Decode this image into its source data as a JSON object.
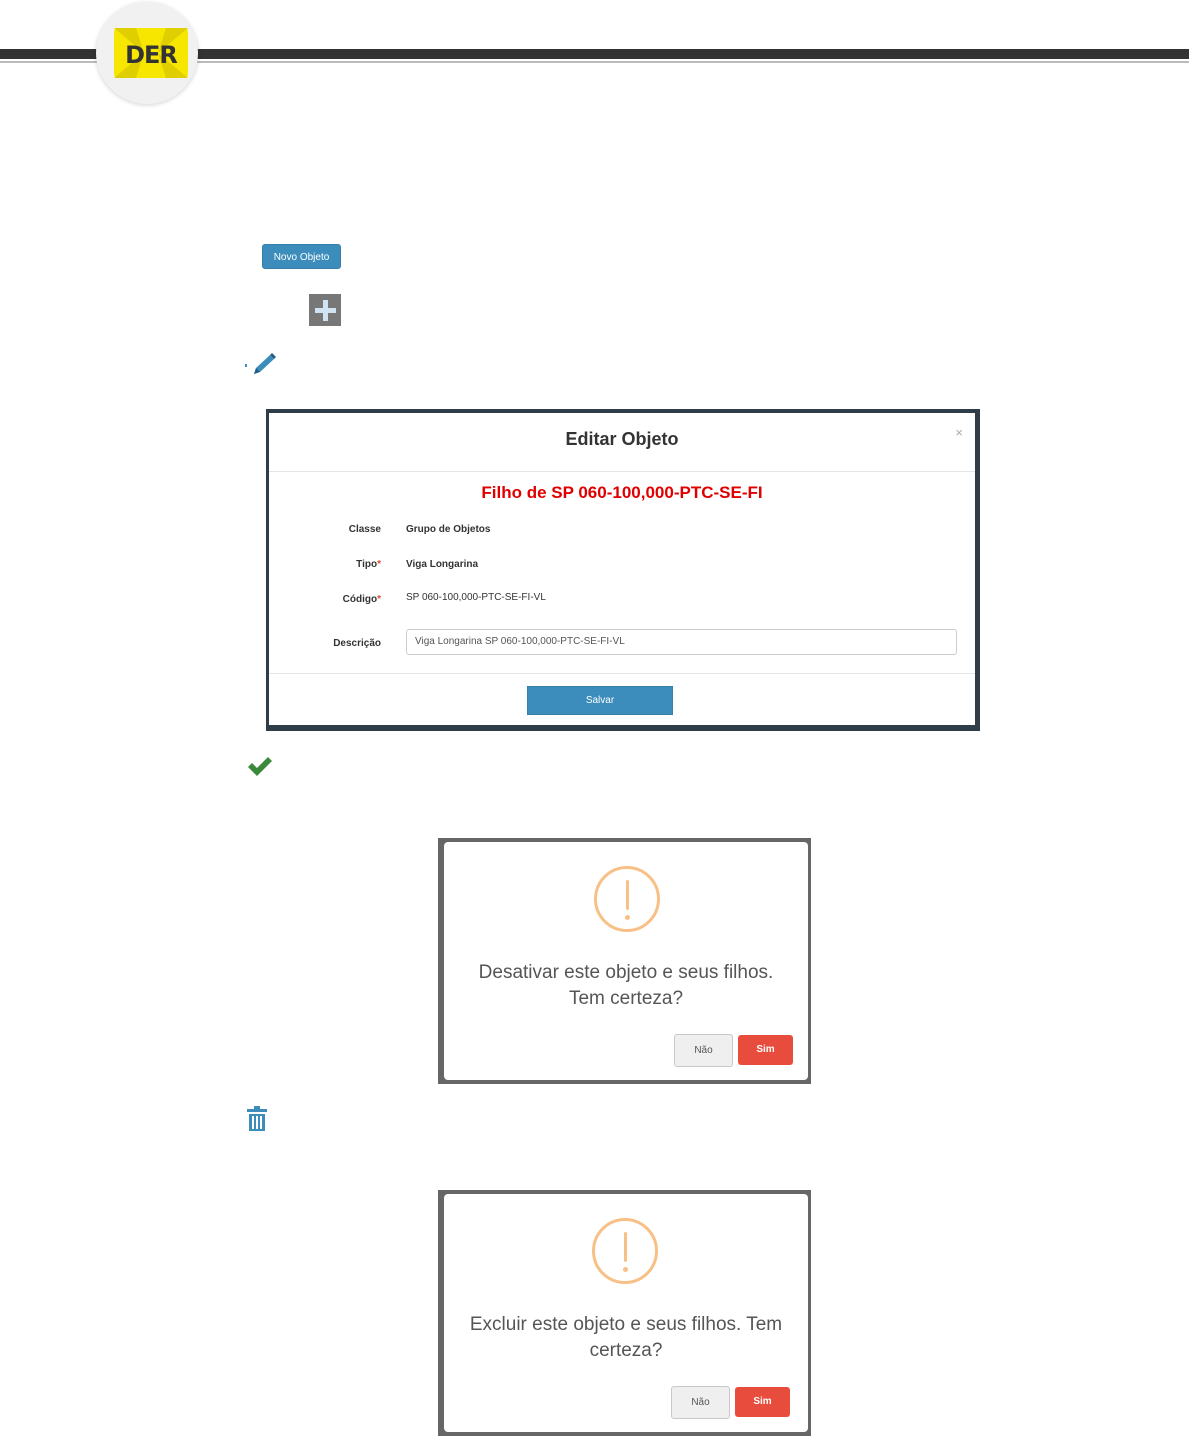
{
  "header": {
    "logo_text": "DER"
  },
  "toolbar": {
    "new_object_label": "Novo Objeto"
  },
  "icons": {
    "add": "plus-icon",
    "edit": "pencil-icon",
    "activate": "check-icon",
    "delete": "trash-icon"
  },
  "edit_modal": {
    "title": "Editar Objeto",
    "close": "×",
    "subtitle": "Filho de SP 060-100,000-PTC-SE-FI",
    "fields": {
      "classe_label": "Classe",
      "classe_value": "Grupo de Objetos",
      "tipo_label": "Tipo",
      "tipo_value": "Viga Longarina",
      "codigo_label": "Código",
      "codigo_value": "SP 060-100,000-PTC-SE-FI-VL",
      "descricao_label": "Descrição",
      "descricao_value": "Viga Longarina SP 060-100,000-PTC-SE-FI-VL",
      "required_mark": "*"
    },
    "save_label": "Salvar"
  },
  "deactivate_dialog": {
    "line1": "Desativar este objeto e seus filhos.",
    "line2": "Tem certeza?",
    "no_label": "Não",
    "yes_label": "Sim"
  },
  "delete_dialog": {
    "line1": "Excluir este objeto e seus filhos. Tem",
    "line2": "certeza?",
    "no_label": "Não",
    "yes_label": "Sim"
  },
  "colors": {
    "primary": "#3c8dbc",
    "danger": "#e74c3c",
    "subtitle_red": "#e00000",
    "warning": "#f8c086",
    "success": "#3a8a3a"
  }
}
